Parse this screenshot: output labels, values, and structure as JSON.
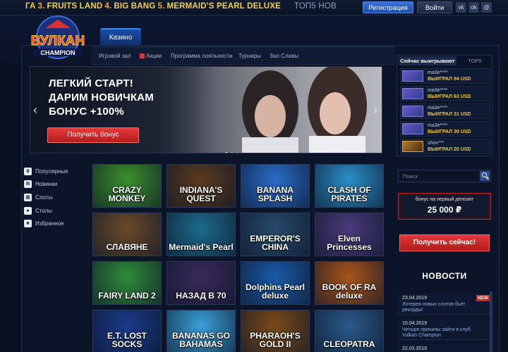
{
  "ticker": [
    {
      "num": "",
      "name": "ГА"
    },
    {
      "num": "3.",
      "name": "FRUITS LAND"
    },
    {
      "num": "4.",
      "name": "BIG BANG"
    },
    {
      "num": "5.",
      "name": "MERMAID'S PEARL DELUXE"
    }
  ],
  "ticker_label": "ТОП5 НОВ",
  "auth": {
    "register": "Регистрация",
    "login": "Войти"
  },
  "social": [
    {
      "icon": "vk-icon",
      "label": "vk"
    },
    {
      "icon": "odnoklassniki-icon",
      "label": "ok"
    },
    {
      "icon": "mail-icon",
      "label": "@"
    }
  ],
  "logo": {
    "line1": "ВУЛКАН",
    "line2": "CHAMPION"
  },
  "main_tab": "Казино",
  "subnav": [
    "Игровой зал",
    "Акции",
    "Программа лояльности",
    "Турниры",
    "Зал Славы"
  ],
  "banner": {
    "headline_1": "ЛЕГКИЙ СТАРТ!",
    "headline_2": "ДАРИМ НОВИЧКАМ",
    "headline_3": "БОНУС +100%",
    "cta": "Получить бонус",
    "prev": "‹",
    "next": "›"
  },
  "winners": {
    "tab_active": "Сейчас выигрывают",
    "tab_other": "TOP5",
    "rows": [
      {
        "user": "ma3e****",
        "amount": "ВЫИГРАЛ 94 USD"
      },
      {
        "user": "ma3e****",
        "amount": "ВЫИГРАЛ 63 USD"
      },
      {
        "user": "ma3e****",
        "amount": "ВЫИГРАЛ 31 USD"
      },
      {
        "user": "ma3e****",
        "amount": "ВЫИГРАЛ 39 USD"
      },
      {
        "user": "shov***",
        "amount": "ВЫИГРАЛ 20 USD"
      }
    ]
  },
  "categories": [
    {
      "icon": "trophy-icon",
      "glyph": "♛",
      "label": "Популярные"
    },
    {
      "icon": "new-badge-icon",
      "glyph": "N",
      "label": "Новинки"
    },
    {
      "icon": "slot-icon",
      "glyph": "▦",
      "label": "Слоты"
    },
    {
      "icon": "table-icon",
      "glyph": "♠",
      "label": "Столы"
    },
    {
      "icon": "star-icon",
      "glyph": "★",
      "label": "Избранное"
    }
  ],
  "games": [
    {
      "title": "CRAZY MONKEY",
      "bg": "#3c8f2c"
    },
    {
      "title": "INDIANA'S QUEST",
      "bg": "#5a3a1e"
    },
    {
      "title": "BANANA SPLASH",
      "bg": "#2a6cc8"
    },
    {
      "title": "CLASH OF PIRATES",
      "bg": "#2a8ec8"
    },
    {
      "title": "СЛАВЯНЕ",
      "bg": "#6a4a28"
    },
    {
      "title": "Mermaid's Pearl",
      "bg": "#1d6a8a"
    },
    {
      "title": "EMPEROR'S CHINA",
      "bg": "#274a6a"
    },
    {
      "title": "Elven Princesses",
      "bg": "#4a3a7a"
    },
    {
      "title": "FAIRY LAND 2",
      "bg": "#2f8a3a"
    },
    {
      "title": "НАЗАД В 70",
      "bg": "#3a2a5a"
    },
    {
      "title": "Dolphins Pearl deluxe",
      "bg": "#1a5aa8"
    },
    {
      "title": "BOOK OF RA deluxe",
      "bg": "#a8541a"
    },
    {
      "title": "E.T. LOST SOCKS",
      "bg": "#1a3a8a"
    },
    {
      "title": "BANANAS GO BAHAMAS",
      "bg": "#3aa0d8"
    },
    {
      "title": "PHARAOH'S GOLD II",
      "bg": "#7a4a18"
    },
    {
      "title": "CLEOPATRA",
      "bg": "#2a5a8a"
    }
  ],
  "search": {
    "placeholder": "Поиск"
  },
  "bonus_box": {
    "label": "бонус на первый депозит",
    "value": "25 000 ₽"
  },
  "get_now": "Получить сейчас!",
  "news_title": "НОВОСТИ",
  "news": [
    {
      "date": "23.04.2019",
      "text": "Лотерея новых слотов бьет рекорды!",
      "badge": "NEW"
    },
    {
      "date": "15.04.2019",
      "text": "Четыре причины зайти в клуб Vulkan Champion",
      "badge": ""
    },
    {
      "date": "22.03.2019",
      "text": "",
      "badge": ""
    }
  ]
}
